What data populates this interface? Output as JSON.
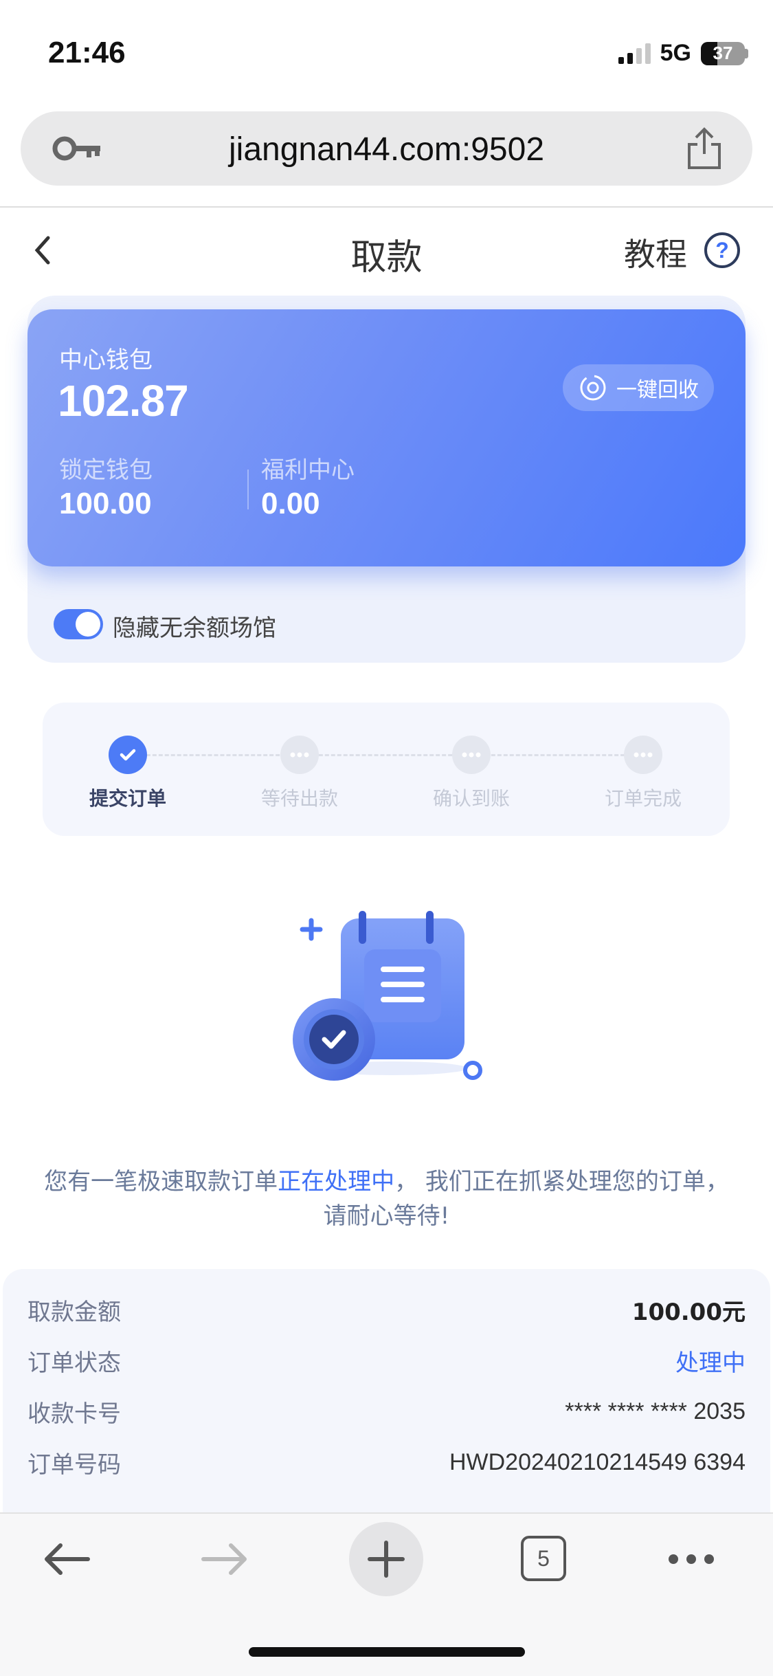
{
  "status_bar": {
    "time": "21:46",
    "network": "5G",
    "battery": "37",
    "battery_level": 0.37
  },
  "browser": {
    "url": "jiangnan44.com:9502",
    "tab_count": "5"
  },
  "header": {
    "title": "取款",
    "tutorial_label": "教程"
  },
  "wallet": {
    "center_label": "中心钱包",
    "center_amount": "102.87",
    "recycle_label": "一键回收",
    "locked_label": "锁定钱包",
    "locked_amount": "100.00",
    "welfare_label": "福利中心",
    "welfare_amount": "0.00",
    "hide_toggle_label": "隐藏无余额场馆",
    "hide_toggle_on": true,
    "gradient_start": "#8aa4f5",
    "gradient_end": "#4b79fb"
  },
  "steps": [
    {
      "label": "提交订单",
      "state": "done"
    },
    {
      "label": "等待出款",
      "state": "pending"
    },
    {
      "label": "确认到账",
      "state": "pending"
    },
    {
      "label": "订单完成",
      "state": "pending"
    }
  ],
  "message": {
    "prefix": "您有一笔极速取款订单",
    "highlight": "正在处理中",
    "suffix": "， 我们正在抓紧处理您的订单，请耐心等待!"
  },
  "order": {
    "amount_label": "取款金额",
    "amount_value": "100.00元",
    "status_label": "订单状态",
    "status_value": "处理中",
    "card_label": "收款卡号",
    "card_value": "**** **** **** 2035",
    "number_label": "订单号码",
    "number_value": "HWD20240210214549 6394"
  },
  "colors": {
    "accent": "#4d7bf6",
    "highlight_text": "#3f70f6"
  }
}
